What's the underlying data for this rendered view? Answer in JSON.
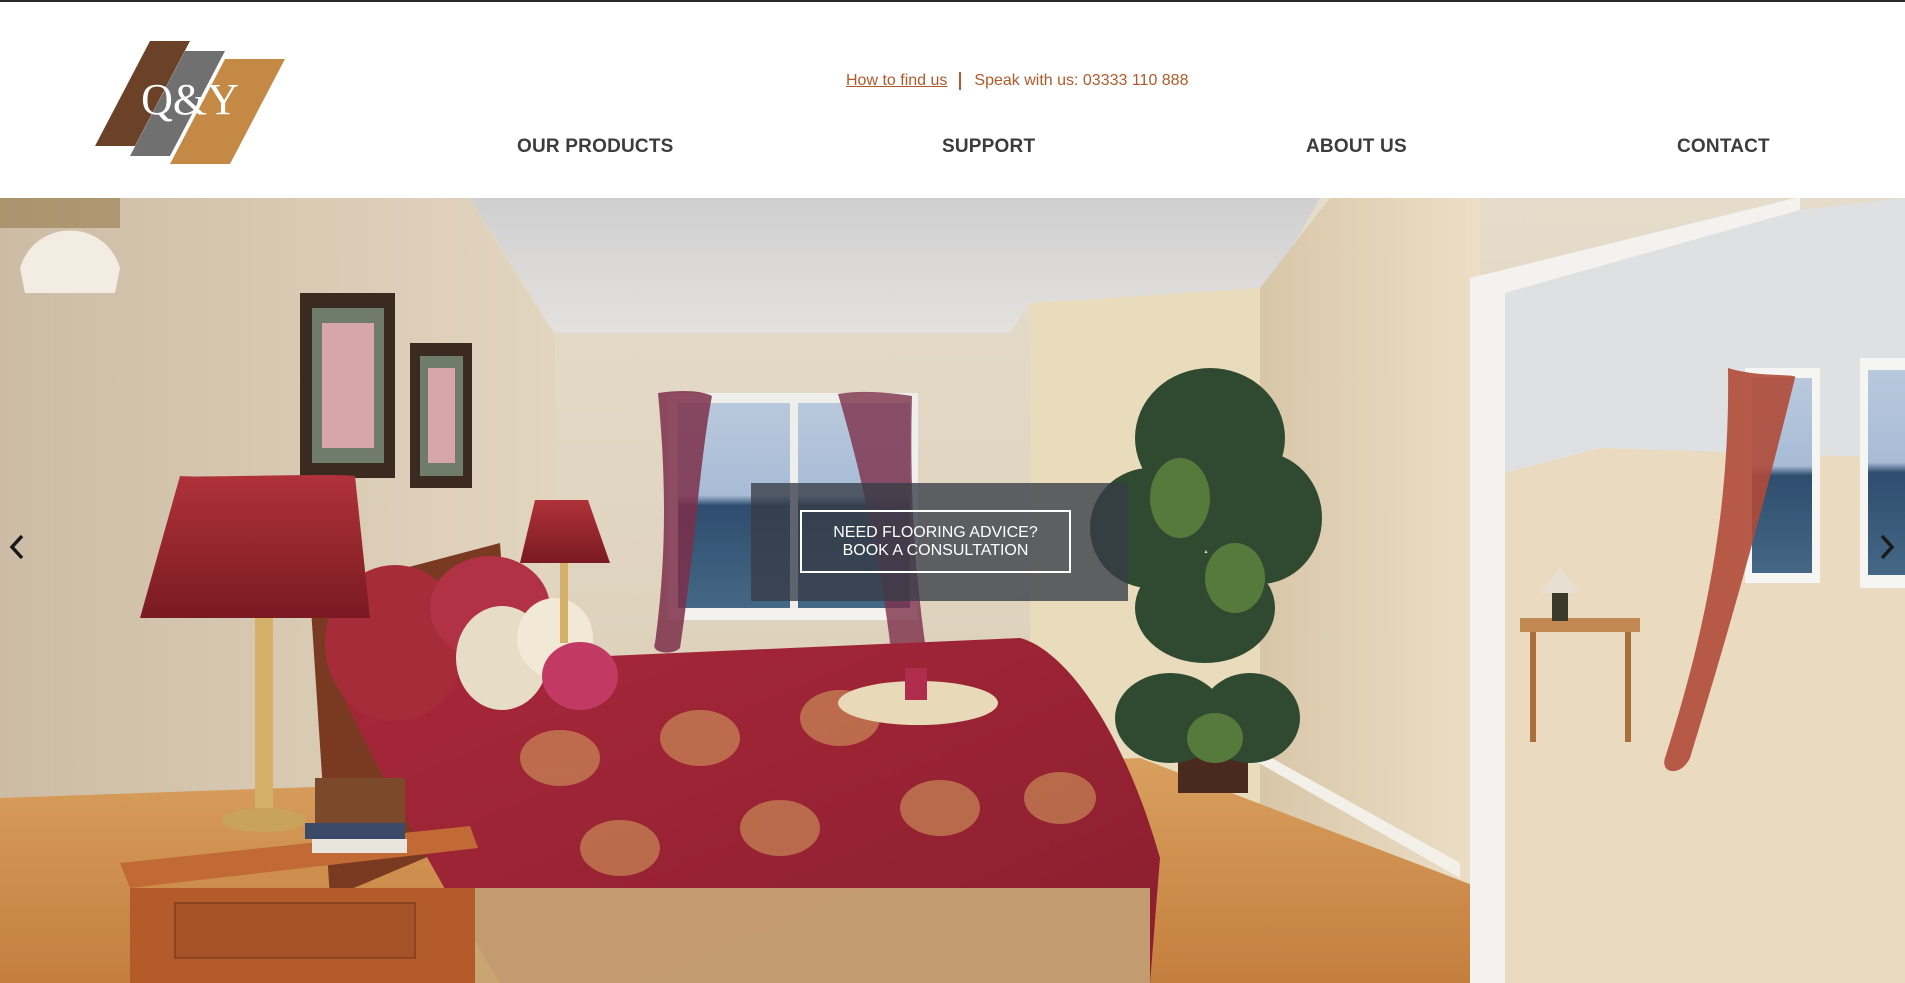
{
  "logo": {
    "text": "Q&Y"
  },
  "contact_bar": {
    "find_link": "How to find us",
    "phone_text": "Speak with us: 03333 110 888"
  },
  "nav": {
    "products": "OUR PRODUCTS",
    "support": "SUPPORT",
    "about": "ABOUT US",
    "contact": "CONTACT"
  },
  "hero": {
    "cta_label": "NEED FLOORING ADVICE? BOOK A CONSULTATION",
    "prev_icon": "chevron-left-icon",
    "next_icon": "chevron-right-icon"
  },
  "colors": {
    "accent": "#b05a2a",
    "nav_text": "#3c3c3c",
    "logo_brown": "#6b4228",
    "logo_grey": "#707070",
    "logo_tan": "#c48a45"
  }
}
